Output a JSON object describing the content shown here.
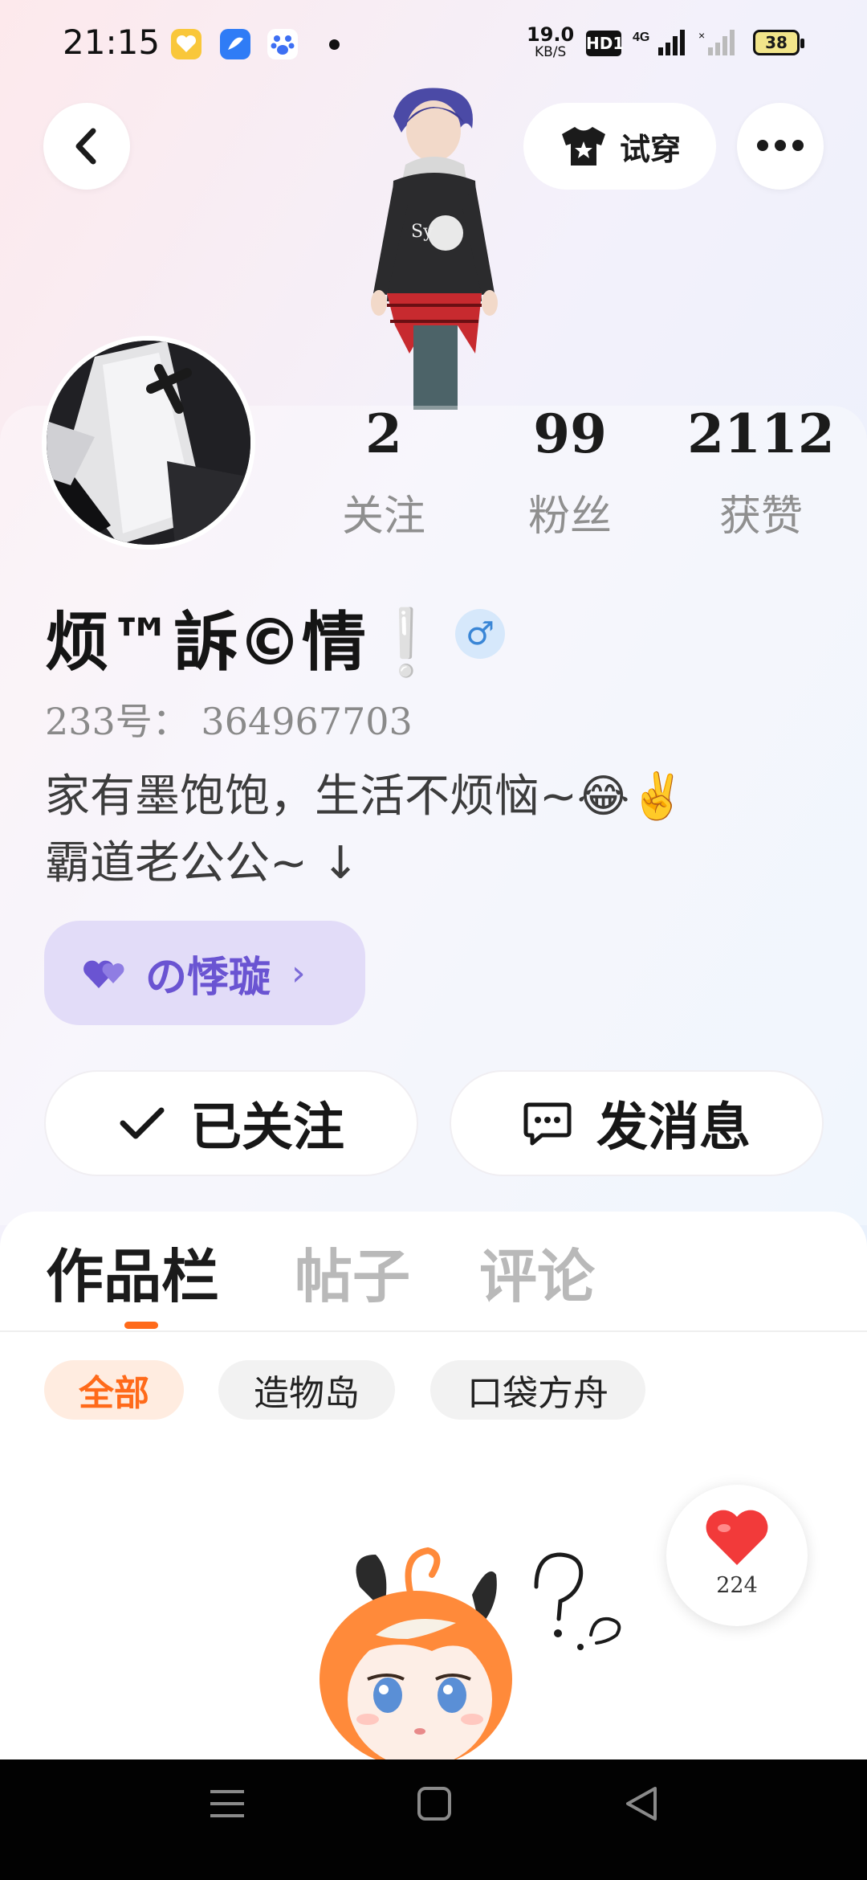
{
  "status_bar": {
    "time": "21:15",
    "net_speed_value": "19.0",
    "net_speed_unit": "KB/S",
    "hd_badge": "HD1",
    "network": "4G",
    "battery": "38",
    "app_icons": [
      "yellow-heart-app-icon",
      "blue-app-icon",
      "paw-app-icon"
    ]
  },
  "header": {
    "back_icon": "chevron-left-icon",
    "tryon_label": "试穿",
    "more_icon": "more-dots-icon"
  },
  "profile": {
    "stats": [
      {
        "value": "2",
        "label": "关注"
      },
      {
        "value": "99",
        "label": "粉丝"
      },
      {
        "value": "2112",
        "label": "获赞"
      }
    ],
    "nickname": "烦™訴©情❕",
    "gender_symbol": "♂",
    "uid": "233号：  364967703",
    "bio_line1": "家有墨饱饱，生活不烦恼~😂✌️",
    "bio_line2": "霸道老公公~ ↓",
    "group_chip_label": "の悸璇",
    "group_chip_chevron": "›"
  },
  "actions": {
    "follow_label": "已关注",
    "message_label": "发消息"
  },
  "tabs": [
    {
      "label": "作品栏",
      "active": true
    },
    {
      "label": "帖子",
      "active": false
    },
    {
      "label": "评论",
      "active": false
    }
  ],
  "filters": [
    {
      "label": "全部",
      "active": true
    },
    {
      "label": "造物岛",
      "active": false
    },
    {
      "label": "口袋方舟",
      "active": false
    }
  ],
  "like_fab": {
    "count": "224"
  },
  "colors": {
    "accent": "#ff6a1a",
    "chip_purple_bg": "#e2dcf8",
    "chip_purple_text": "#6a54d2",
    "gender_blue": "#3a86d6"
  }
}
